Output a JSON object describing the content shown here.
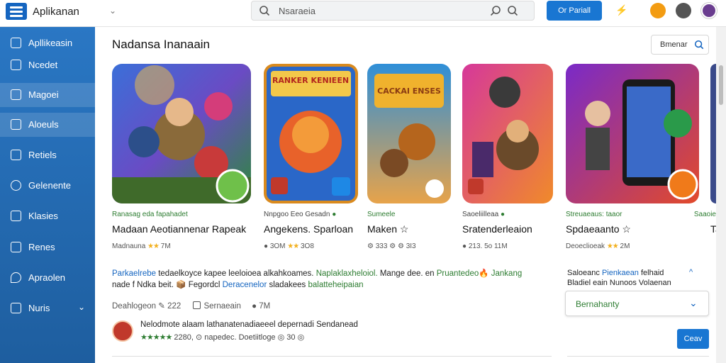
{
  "app": {
    "title": "Aplikanan"
  },
  "search": {
    "placeholder": "Nsaraeia"
  },
  "header": {
    "primary_button": "Or Pariall"
  },
  "sidebar": {
    "items": [
      {
        "label": "Apllikeasin",
        "icon": "apps-icon"
      },
      {
        "label": "Ncedet",
        "icon": "image-icon"
      },
      {
        "label": "Magoei",
        "icon": "book-icon"
      },
      {
        "label": "Aloeuls",
        "icon": "tablet-icon"
      },
      {
        "label": "Retiels",
        "icon": "gallery-icon"
      },
      {
        "label": "Gelenente",
        "icon": "link-icon"
      },
      {
        "label": "Klasies",
        "icon": "calendar-icon"
      },
      {
        "label": "Renes",
        "icon": "calendar-icon"
      },
      {
        "label": "Apraolen",
        "icon": "location-icon"
      },
      {
        "label": "Nuris",
        "icon": "mail-icon"
      }
    ]
  },
  "section": {
    "title": "Nadansa Inanaain",
    "search_label": "Bmenar"
  },
  "cards": [
    {
      "sub": "Ranasag eda fapahadet",
      "name": "Madaan Aeotiannenar Rapeak",
      "meta": "Madnauna",
      "rating": "7M",
      "art_title": ""
    },
    {
      "sub": "Nnpgoo Eeo Gesadn",
      "name": "Angekens. Sparloan",
      "meta": "3OM",
      "rating": "3O8",
      "art_title": "RANKER KENIEEN"
    },
    {
      "sub": "Sumeele",
      "name": "Maken",
      "meta": "333",
      "rating": "3I3",
      "art_title": "CACKAI ENSES"
    },
    {
      "sub": "Saoeliilleaa",
      "name": "Sratenderleaion",
      "meta": "213.",
      "rating": "5o 11M",
      "art_title": ""
    },
    {
      "sub": "Streuaeaus: taaor",
      "name": "Spdaeaanto",
      "meta": "Deoeclioeak",
      "rating": "2M",
      "art_title": ""
    }
  ],
  "card_partial": {
    "sub": "Saaoie",
    "name": "Ta"
  },
  "description": {
    "line1_a": "Parkaelrebe",
    "line1_b": " tedaelkoyce kapee leeloioea alkahkoames. ",
    "line1_c": "Naplaklaxheloiol. ",
    "line1_d": "Mange dee. en ",
    "line1_e": "Pruantedeo",
    "line1_f": " Jankang",
    "line2_a": "nade f Ndka beit. ",
    "line2_b": "Fegordcl ",
    "line2_c": "Deracenelor",
    "line2_d": " sladakees ",
    "line2_e": "balatteheipaian"
  },
  "desc_meta": {
    "label": "Deahlogeon",
    "count": "222",
    "checkbox_label": "Sernaeain",
    "comments": "7M"
  },
  "review": {
    "title": "Nelodmote alaam lathanatenadiaeeel depernadi Sendanead",
    "rating_count": "2280,",
    "author": "napedec.",
    "extra": "Doetiitloge",
    "num": "30"
  },
  "side_panel": {
    "line1_a": "Saloeanc ",
    "line1_b": "Pienkaean",
    "line1_c": " felhaid",
    "line2": "Bladiel eain Nunoos Volaenan",
    "dropdown": "Bernahanty",
    "button": "Ceav"
  },
  "colors": {
    "accent": "#1976d2",
    "sidebar": "#2a77c4",
    "green": "#2e7d32"
  }
}
